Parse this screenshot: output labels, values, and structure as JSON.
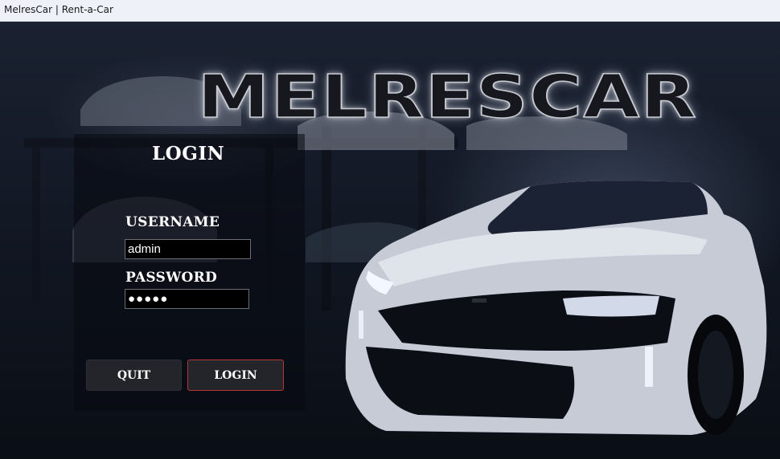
{
  "window": {
    "title": "MelresCar | Rent-a-Car"
  },
  "logo": {
    "text": "MELRESCAR"
  },
  "login_form": {
    "heading": "LOGIN",
    "username_label": "USERNAME",
    "username_value": "admin",
    "password_label": "PASSWORD",
    "password_value": "●●●●●",
    "quit_label": "QUIT",
    "login_label": "LOGIN"
  },
  "colors": {
    "login_button_border": "#b8363a",
    "panel_background": "#080a10",
    "background": "#0b0f17"
  }
}
